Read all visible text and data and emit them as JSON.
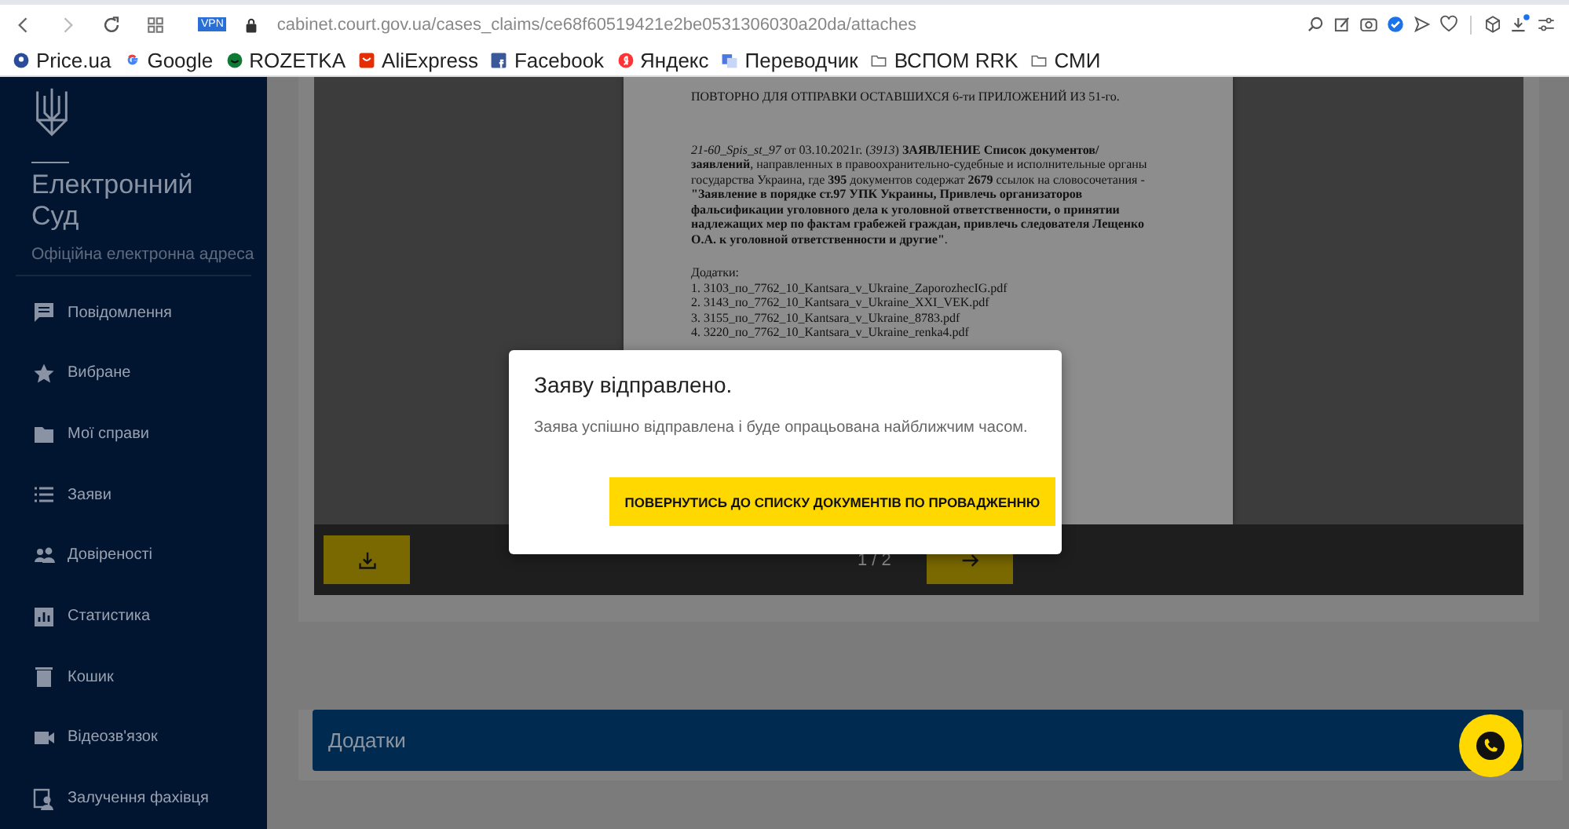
{
  "browser": {
    "vpn_badge": "VPN",
    "url": "cabinet.court.gov.ua/cases_claims/ce68f60519421e2be0531306030a20da/attaches",
    "toolbar_icons": [
      {
        "kind": "zoom"
      },
      {
        "kind": "edit"
      },
      {
        "kind": "camera"
      },
      {
        "kind": "shield"
      },
      {
        "kind": "send"
      },
      {
        "kind": "heart"
      },
      {
        "kind": "cube"
      },
      {
        "kind": "download"
      },
      {
        "kind": "sliders"
      }
    ],
    "bookmarks": [
      {
        "label": "Price.ua",
        "kind": "price"
      },
      {
        "label": "Google",
        "kind": "google"
      },
      {
        "label": "ROZETKA",
        "kind": "rozetka"
      },
      {
        "label": "AliExpress",
        "kind": "ali"
      },
      {
        "label": "Facebook",
        "kind": "facebook"
      },
      {
        "label": "Яндекс",
        "kind": "yandex"
      },
      {
        "label": "Переводчик",
        "kind": "translate"
      },
      {
        "label": "ВСПОМ RRK",
        "kind": "folder"
      },
      {
        "label": "СМИ",
        "kind": "folder"
      }
    ]
  },
  "sidebar": {
    "title": "Електронний Суд",
    "subtitle": "Офіційна електронна адреса",
    "items": [
      {
        "label": "Повідомлення",
        "kind": "message"
      },
      {
        "label": "Вибране",
        "kind": "star"
      },
      {
        "label": "Мої справи",
        "kind": "folder"
      },
      {
        "label": "Заяви",
        "kind": "list"
      },
      {
        "label": "Довіреності",
        "kind": "people"
      },
      {
        "label": "Статистика",
        "kind": "chart"
      },
      {
        "label": "Кошик",
        "kind": "trash"
      },
      {
        "label": "Відеозв'язок",
        "kind": "video"
      },
      {
        "label": "Залучення фахівця",
        "kind": "expert"
      }
    ]
  },
  "document": {
    "heading": "ПОВТОРНО ДЛЯ ОТПРАВКИ ОСТАВШИХСЯ 6-ти ПРИЛОЖЕНИЙ ИЗ 51-го.",
    "paragraph": "*21-60_Spis_st_97* от 03.10.2021г. (*3913*) **ЗАЯВЛЕНИЕ** **Список документов/ заявлений**, направленных в правоохранительно-судебные и исполнительные органы государства Украина, где **395** документов содержат **2679** ссылок на словосочетания - **\"Заявление в порядке ст.97 УПК Украины, Привлечь организаторов фальсификации уголовного дела к уголовной ответственности, о принятии надлежащих мер по фактам грабежей граждан, привлечь следователя Лещенко О.А. к уголовной ответственности и другие\"**.",
    "attachments_label": "Додатки:",
    "attachments": [
      "1. 3103_по_7762_10_Kantsara_v_Ukraine_ZaporozhecIG.pdf",
      "2. 3143_по_7762_10_Kantsara_v_Ukraine_XXI_VEK.pdf",
      "3. 3155_по_7762_10_Kantsara_v_Ukraine_8783.pdf",
      "4. 3220_по_7762_10_Kantsara_v_Ukraine_renka4.pdf"
    ]
  },
  "viewer": {
    "page_counter": "1 / 2"
  },
  "section": {
    "title": "Додатки"
  },
  "dialog": {
    "title": "Заяву відправлено.",
    "message": "Заява успішно відправлена і буде опрацьована найближчим часом.",
    "button": "ПОВЕРНУТИСЬ ДО СПИСКУ ДОКУМЕНТІВ ПО ПРОВАДЖЕННЮ"
  }
}
